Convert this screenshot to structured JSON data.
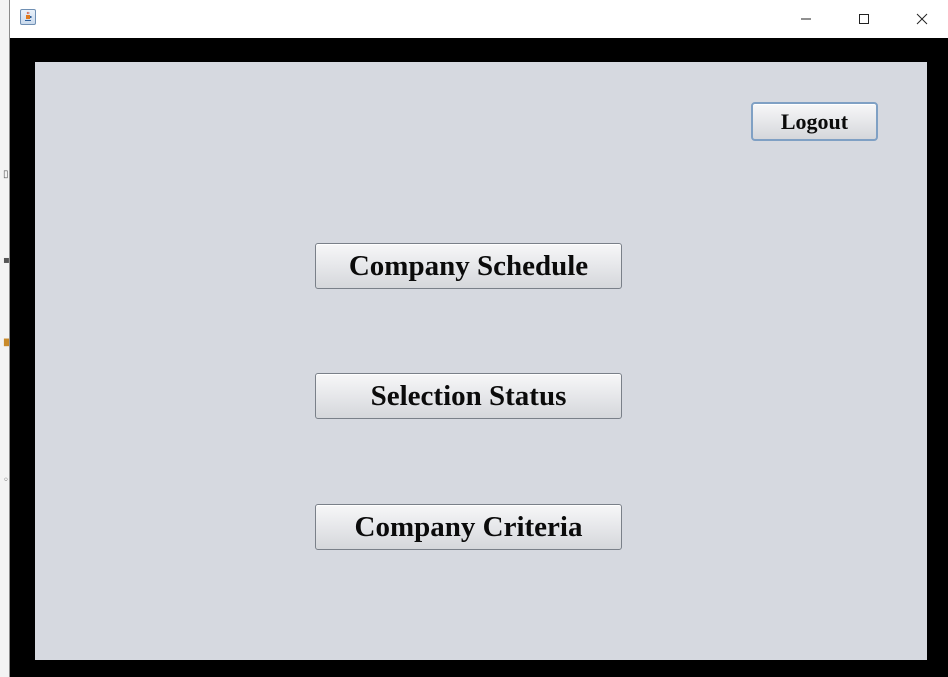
{
  "window": {
    "icon": "java-app-icon",
    "controls": {
      "minimize_icon": "minimize-icon",
      "maximize_icon": "maximize-icon",
      "close_icon": "close-icon"
    }
  },
  "panel": {
    "background_color": "#d6d9e0",
    "logout_label": "Logout",
    "buttons": [
      {
        "label": "Company Schedule"
      },
      {
        "label": "Selection Status"
      },
      {
        "label": "Company Criteria"
      }
    ]
  },
  "colors": {
    "frame": "#000000",
    "logout_focus_border": "#7fa0c4"
  }
}
